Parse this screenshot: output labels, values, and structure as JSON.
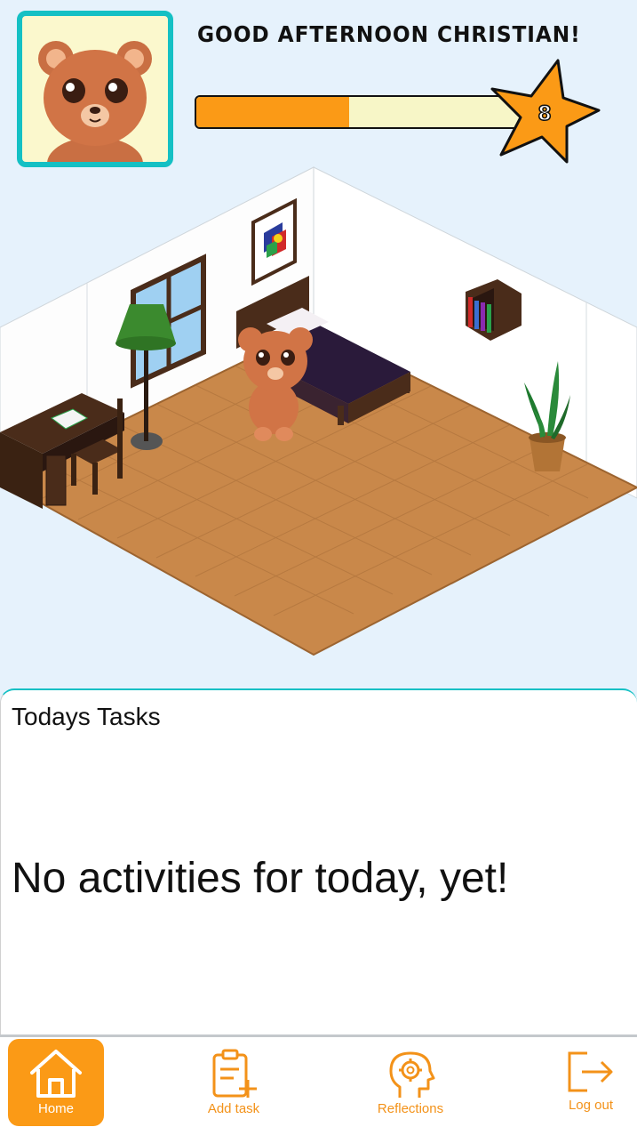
{
  "header": {
    "greeting": "GOOD AFTERNOON CHRISTIAN!",
    "level": "8",
    "xp_progress": 0.46,
    "avatar": "bear-avatar-icon"
  },
  "room": {
    "scene": "isometric-bedroom",
    "character": "bear-character-icon"
  },
  "tasks": {
    "title": "Todays Tasks",
    "empty_message": "No activities for today, yet!"
  },
  "nav": {
    "items": [
      {
        "label": "Home",
        "icon": "home-icon",
        "active": true
      },
      {
        "label": "Add task",
        "icon": "add-task-icon",
        "active": false
      },
      {
        "label": "Reflections",
        "icon": "reflections-icon",
        "active": false
      },
      {
        "label": "Log out",
        "icon": "logout-icon",
        "active": false
      }
    ]
  },
  "colors": {
    "accent": "#fb9a16",
    "frame": "#14c0c4",
    "background": "#e6f2fc"
  }
}
